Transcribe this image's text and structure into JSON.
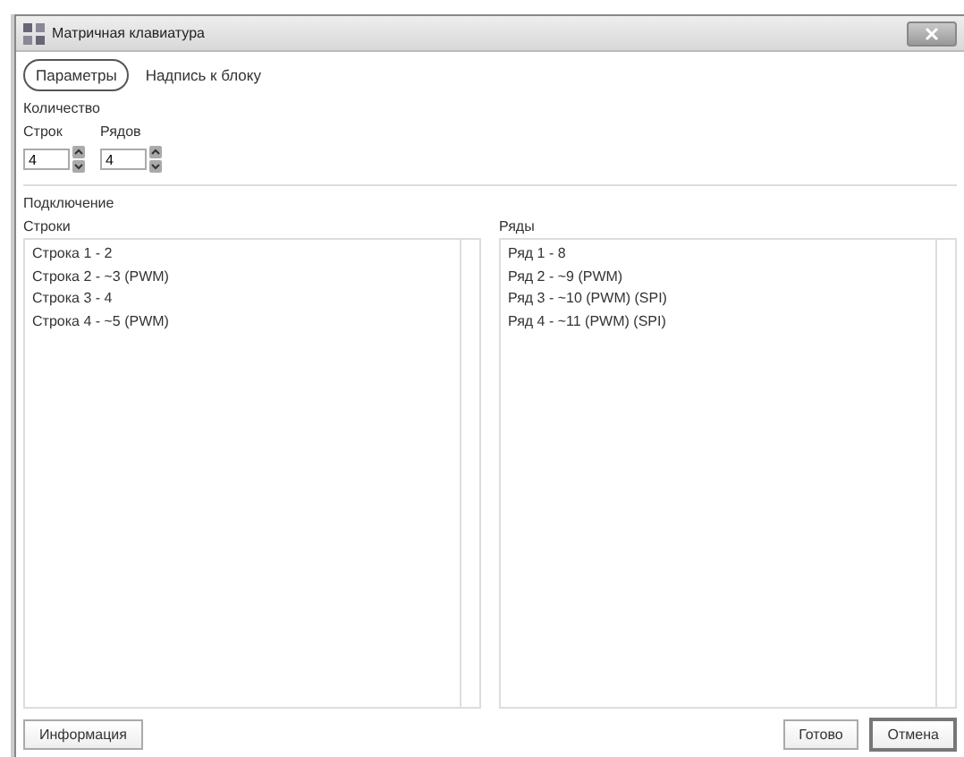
{
  "window": {
    "title": "Матричная клавиатура"
  },
  "tabs": [
    {
      "label": "Параметры",
      "selected": true
    },
    {
      "label": "Надпись к блоку",
      "selected": false
    }
  ],
  "quantity": {
    "title": "Количество",
    "fields": [
      {
        "label": "Строк",
        "value": "4"
      },
      {
        "label": "Рядов",
        "value": "4"
      }
    ]
  },
  "connection": {
    "title": "Подключение",
    "lists": [
      {
        "title": "Строки",
        "items": [
          "Строка 1 - 2",
          "Строка 2 - ~3 (PWM)",
          "Строка 3 - 4",
          "Строка 4 - ~5 (PWM)"
        ]
      },
      {
        "title": "Ряды",
        "items": [
          "Ряд 1 - 8",
          "Ряд 2 - ~9 (PWM)",
          "Ряд 3 - ~10 (PWM) (SPI)",
          "Ряд 4 - ~11 (PWM) (SPI)"
        ]
      }
    ]
  },
  "buttons": {
    "left": [
      "Информация"
    ],
    "right": [
      {
        "label": "Готово",
        "default": false
      },
      {
        "label": "Отмена",
        "default": true
      }
    ]
  }
}
